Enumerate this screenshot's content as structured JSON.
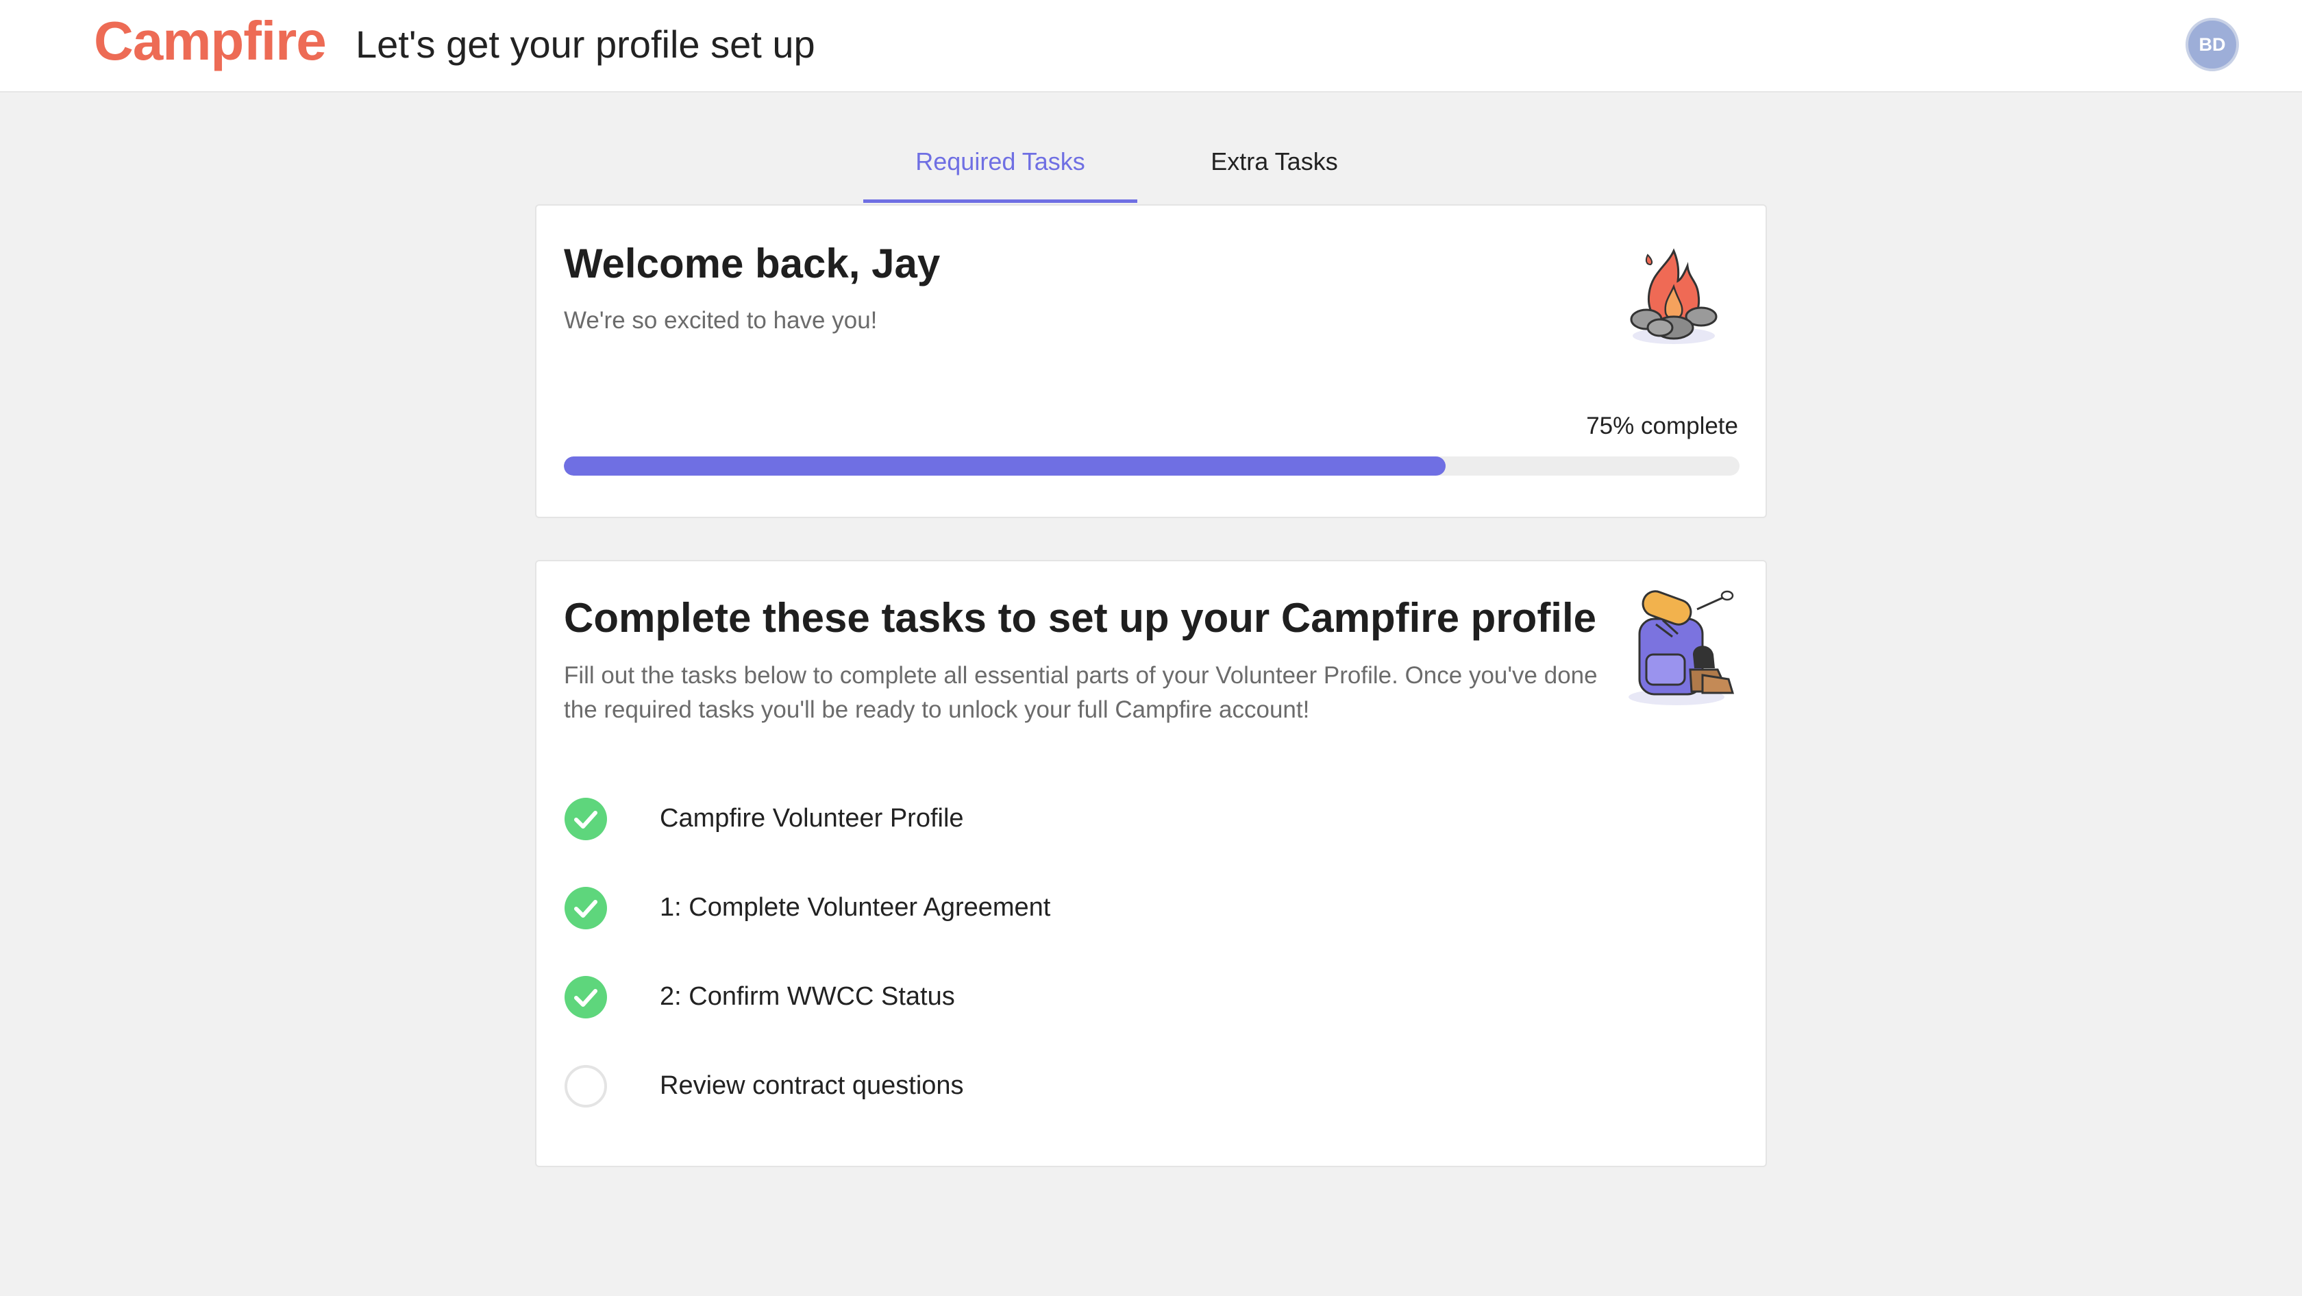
{
  "header": {
    "logo": "Campfire",
    "title": "Let's get your profile set up",
    "avatar_initials": "BD"
  },
  "tabs": [
    {
      "label": "Required Tasks",
      "active": true
    },
    {
      "label": "Extra Tasks",
      "active": false
    }
  ],
  "welcome": {
    "title": "Welcome back, Jay",
    "subtitle": "We're so excited to have you!",
    "progress_label": "75% complete",
    "progress_fraction": 0.75
  },
  "tasks_card": {
    "title": "Complete these tasks to set up your Campfire profile",
    "description": "Fill out the tasks below to complete all essential parts of your Volunteer Profile. Once you've done the required tasks you'll be ready to unlock your full Campfire account!",
    "tasks": [
      {
        "label": "Campfire Volunteer Profile",
        "completed": true
      },
      {
        "label": "1: Complete Volunteer Agreement",
        "completed": true
      },
      {
        "label": "2: Confirm WWCC Status",
        "completed": true
      },
      {
        "label": "Review contract questions",
        "completed": false
      }
    ]
  },
  "colors": {
    "brand": "#ed6b55",
    "accent": "#6f6fe3",
    "success": "#5ed67c",
    "avatar": "#9daed8"
  },
  "icons": {
    "complete": "check-circle-icon",
    "incomplete": "empty-circle-icon",
    "welcome_illustration": "campfire-illustration",
    "tasks_illustration": "backpack-illustration"
  }
}
